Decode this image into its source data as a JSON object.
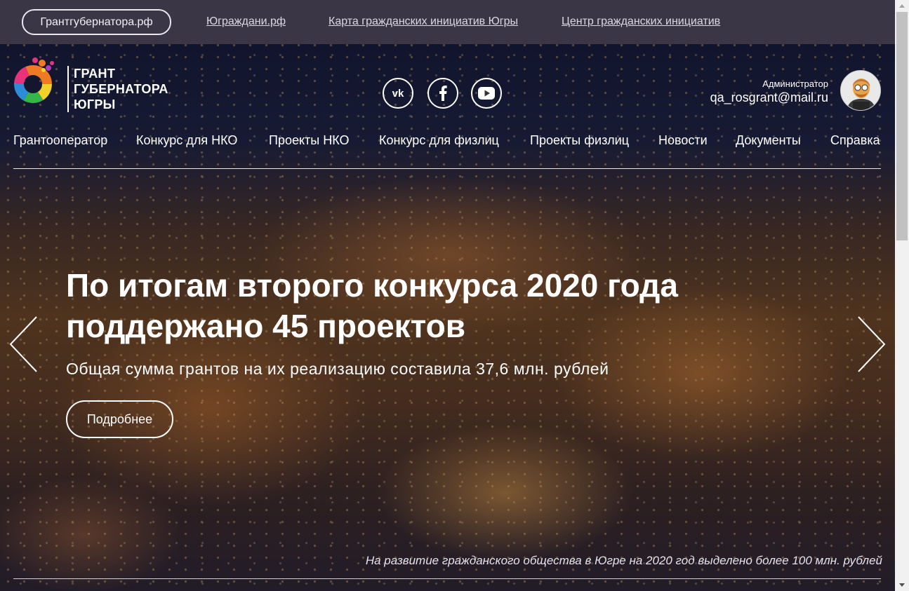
{
  "topbar": {
    "pill_label": "Грантгубернатора.рф",
    "links": [
      "Юграждани.рф",
      "Карта гражданских инициатив Югры",
      "Центр гражданских инициатив"
    ]
  },
  "logo": {
    "line1": "ГРАНТ",
    "line2": "ГУБЕРНАТОРА",
    "line3": "ЮГРЫ"
  },
  "social": [
    "vk-icon",
    "facebook-icon",
    "youtube-icon"
  ],
  "user": {
    "role": "Администратор",
    "email": "qa_rosgrant@mail.ru"
  },
  "nav": [
    "Грантооператор",
    "Конкурс для НКО",
    "Проекты НКО",
    "Конкурс для физлиц",
    "Проекты физлиц",
    "Новости",
    "Документы",
    "Справка"
  ],
  "hero": {
    "title_line1": "По итогам второго конкурса 2020 года",
    "title_line2": "поддержано 45 проектов",
    "subtitle": "Общая сумма грантов на их реализацию составила 37,6 млн. рублей",
    "button_label": "Подробнее",
    "caption": "На развитие гражданского общества в Югре на 2020 год выделено более 100 млн. рублей"
  },
  "colors": {
    "topbar": "#3a3645",
    "text": "#ffffff"
  }
}
